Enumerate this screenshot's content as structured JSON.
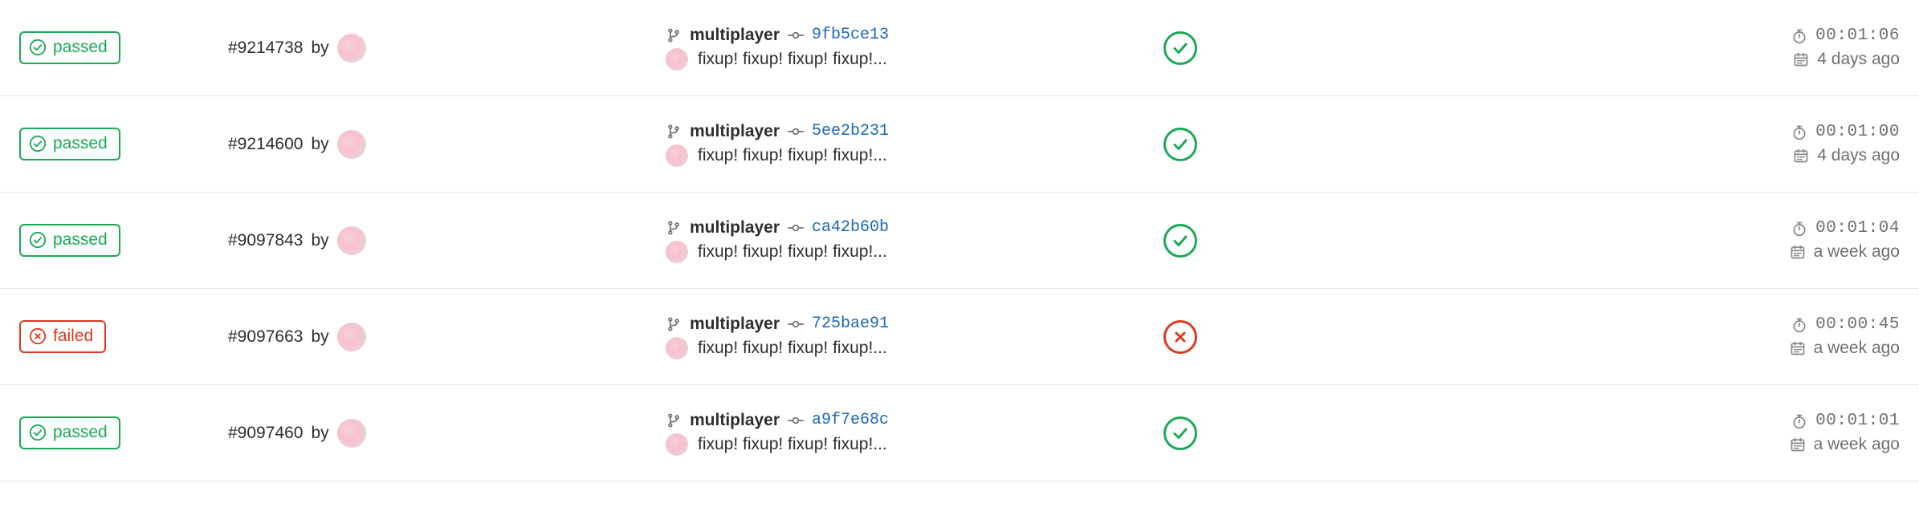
{
  "status_labels": {
    "passed": "passed",
    "failed": "failed"
  },
  "by_label": "by",
  "pipelines": [
    {
      "status": "passed",
      "id": "#9214738",
      "branch": "multiplayer",
      "sha": "9fb5ce13",
      "message": "fixup! fixup! fixup! fixup!...",
      "stage": "passed",
      "duration": "00:01:06",
      "when": "4 days ago"
    },
    {
      "status": "passed",
      "id": "#9214600",
      "branch": "multiplayer",
      "sha": "5ee2b231",
      "message": "fixup! fixup! fixup! fixup!...",
      "stage": "passed",
      "duration": "00:01:00",
      "when": "4 days ago"
    },
    {
      "status": "passed",
      "id": "#9097843",
      "branch": "multiplayer",
      "sha": "ca42b60b",
      "message": "fixup! fixup! fixup! fixup!...",
      "stage": "passed",
      "duration": "00:01:04",
      "when": "a week ago"
    },
    {
      "status": "failed",
      "id": "#9097663",
      "branch": "multiplayer",
      "sha": "725bae91",
      "message": "fixup! fixup! fixup! fixup!...",
      "stage": "failed",
      "duration": "00:00:45",
      "when": "a week ago"
    },
    {
      "status": "passed",
      "id": "#9097460",
      "branch": "multiplayer",
      "sha": "a9f7e68c",
      "message": "fixup! fixup! fixup! fixup!...",
      "stage": "passed",
      "duration": "00:01:01",
      "when": "a week ago"
    }
  ]
}
